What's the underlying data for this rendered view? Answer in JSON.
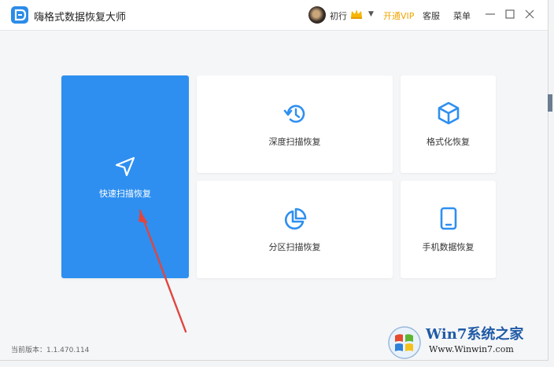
{
  "app": {
    "title": "嗨格式数据恢复大师"
  },
  "header": {
    "username": "初行",
    "vip_label": "开通VIP",
    "service_label": "客服",
    "menu_label": "菜单"
  },
  "cards": {
    "quick_scan": "快速扫描恢复",
    "deep_scan": "深度扫描恢复",
    "format_recovery": "格式化恢复",
    "partition_scan": "分区扫描恢复",
    "phone_recovery": "手机数据恢复"
  },
  "footer": {
    "version": "当前版本：1.1.470.114"
  },
  "watermark": {
    "title": "Win7系统之家",
    "url": "Www.Winwin7.com"
  },
  "colors": {
    "accent": "#2e8ff0",
    "vip": "#f0a500",
    "arrow": "#e0463f"
  }
}
